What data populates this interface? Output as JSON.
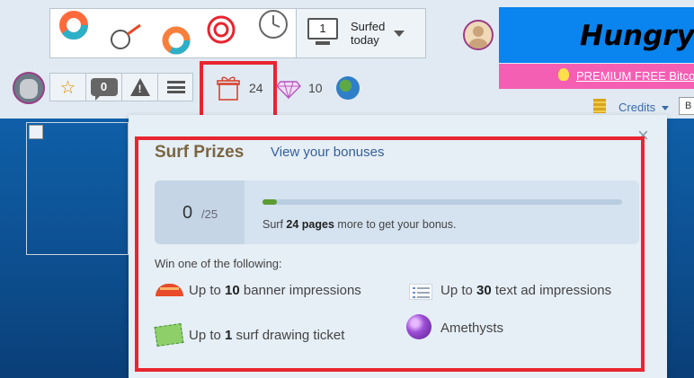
{
  "toolbar": {
    "surfed_count": "1",
    "surfed_label_line1": "Surfed",
    "surfed_label_line2": "today",
    "messages_count": "0",
    "bonus_pages_count": "24",
    "gems_count": "10",
    "credits_label": "Credits",
    "small_button_label": "B"
  },
  "ads": {
    "banner_text": "Hungry",
    "premium_text": "PREMIUM FREE Bitco"
  },
  "popup": {
    "title": "Surf Prizes",
    "view_bonuses_link": "View your bonuses",
    "close_label": "×",
    "progress": {
      "current": "0",
      "total": "/25",
      "fraction": 0.04,
      "message_prefix": "Surf",
      "message_pages": "24 pages",
      "message_suffix": "more to get your bonus."
    },
    "win_label": "Win one of the following:",
    "prizes": [
      {
        "prefix": "Up to",
        "amount": "10",
        "suffix": "banner impressions",
        "icon": "banner-ribbon-icon"
      },
      {
        "prefix": "Up to",
        "amount": "30",
        "suffix": "text ad impressions",
        "icon": "text-ad-icon"
      },
      {
        "prefix": "Up to",
        "amount": "1",
        "suffix": "surf drawing ticket",
        "icon": "ticket-icon"
      },
      {
        "prefix": "",
        "amount": "",
        "suffix": "Amethysts",
        "icon": "amethyst-icon"
      }
    ]
  },
  "colors": {
    "highlight": "#e8252f",
    "link": "#35609a",
    "progress_fill": "#5c9a34",
    "title": "#7a6640"
  }
}
